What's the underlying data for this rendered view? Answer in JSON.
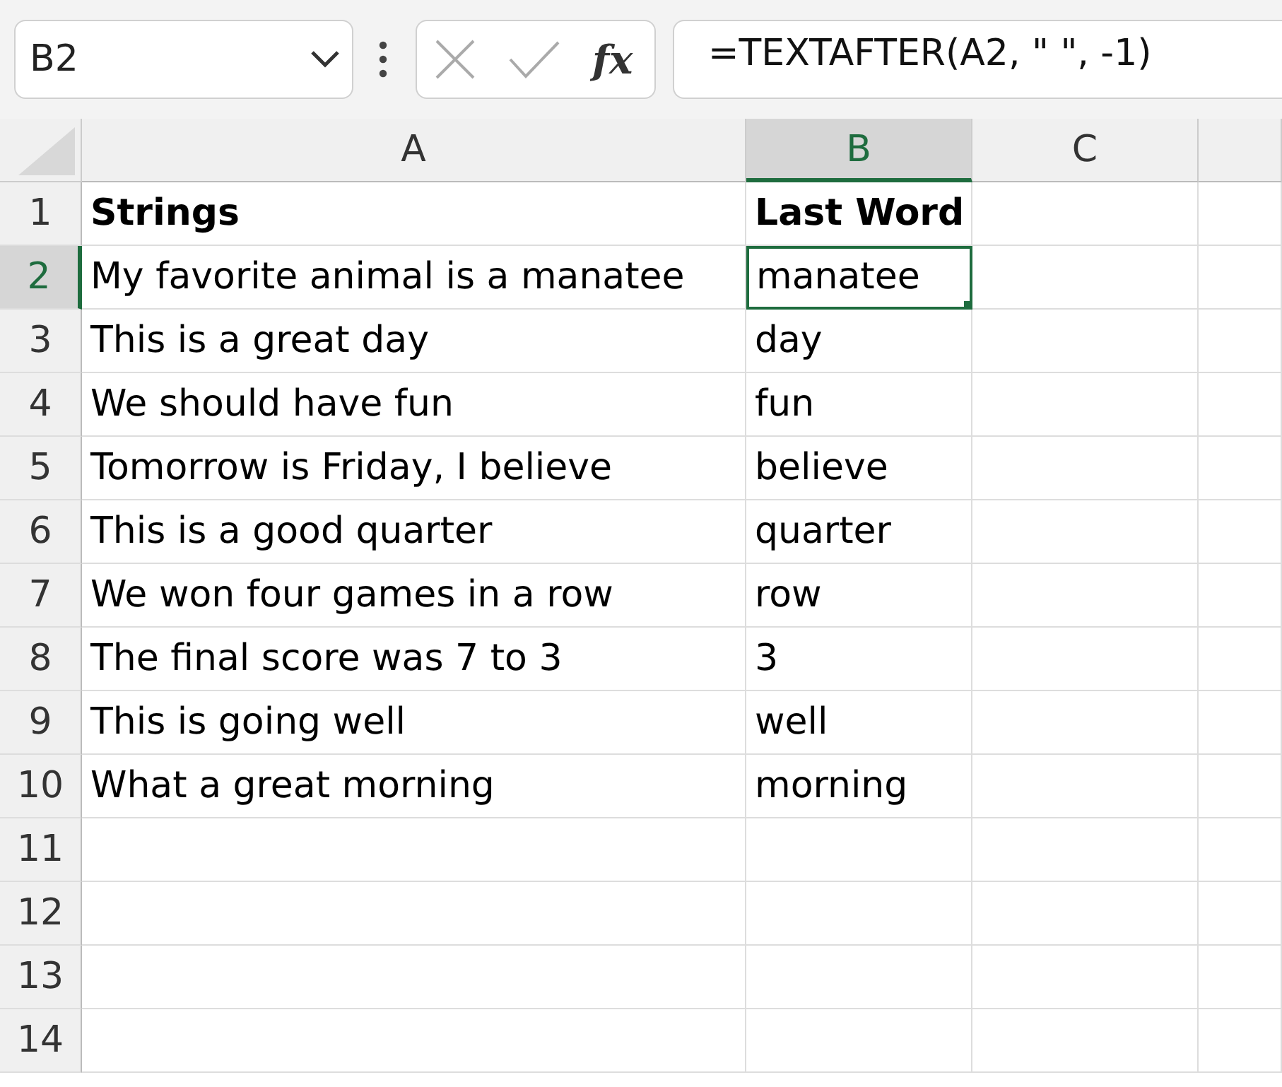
{
  "name_box": {
    "value": "B2"
  },
  "formula_bar": {
    "fx_label": "fx",
    "value": "=TEXTAFTER(A2, \" \", -1)"
  },
  "columns": [
    {
      "label": "A",
      "selected": false
    },
    {
      "label": "B",
      "selected": true
    },
    {
      "label": "C",
      "selected": false
    }
  ],
  "rows": [
    {
      "number": "1",
      "selected": false,
      "bold": true,
      "cells": [
        {
          "text": "Strings",
          "active": false
        },
        {
          "text": "Last Word",
          "active": false
        }
      ]
    },
    {
      "number": "2",
      "selected": true,
      "bold": false,
      "cells": [
        {
          "text": "My favorite animal is a manatee",
          "active": false
        },
        {
          "text": "manatee",
          "active": true
        }
      ]
    },
    {
      "number": "3",
      "selected": false,
      "bold": false,
      "cells": [
        {
          "text": "This is a great day",
          "active": false
        },
        {
          "text": "day",
          "active": false
        }
      ]
    },
    {
      "number": "4",
      "selected": false,
      "bold": false,
      "cells": [
        {
          "text": "We should have fun",
          "active": false
        },
        {
          "text": "fun",
          "active": false
        }
      ]
    },
    {
      "number": "5",
      "selected": false,
      "bold": false,
      "cells": [
        {
          "text": "Tomorrow is Friday, I believe",
          "active": false
        },
        {
          "text": "believe",
          "active": false
        }
      ]
    },
    {
      "number": "6",
      "selected": false,
      "bold": false,
      "cells": [
        {
          "text": "This is a good quarter",
          "active": false
        },
        {
          "text": "quarter",
          "active": false
        }
      ]
    },
    {
      "number": "7",
      "selected": false,
      "bold": false,
      "cells": [
        {
          "text": "We won four games in a row",
          "active": false
        },
        {
          "text": "row",
          "active": false
        }
      ]
    },
    {
      "number": "8",
      "selected": false,
      "bold": false,
      "cells": [
        {
          "text": "The final score was 7 to 3",
          "active": false
        },
        {
          "text": "3",
          "active": false
        }
      ]
    },
    {
      "number": "9",
      "selected": false,
      "bold": false,
      "cells": [
        {
          "text": "This is going well",
          "active": false
        },
        {
          "text": "well",
          "active": false
        }
      ]
    },
    {
      "number": "10",
      "selected": false,
      "bold": false,
      "cells": [
        {
          "text": "What a great morning",
          "active": false
        },
        {
          "text": "morning",
          "active": false
        }
      ]
    },
    {
      "number": "11",
      "selected": false
    },
    {
      "number": "12",
      "selected": false
    },
    {
      "number": "13",
      "selected": false
    },
    {
      "number": "14",
      "selected": false
    }
  ]
}
